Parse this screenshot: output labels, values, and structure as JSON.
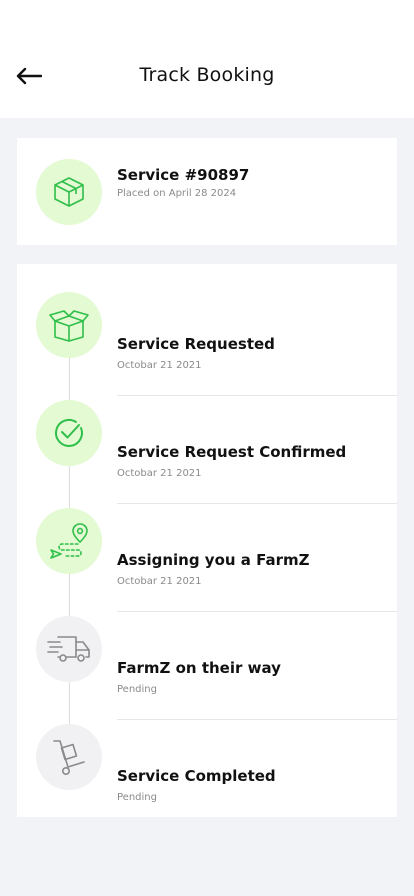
{
  "header": {
    "title": "Track Booking",
    "back_icon": "arrow-left-icon"
  },
  "summary": {
    "icon": "box-icon",
    "service_label": "Service #90897",
    "placed_on": "Placed on April 28 2024"
  },
  "steps": [
    {
      "title": "Service Requested",
      "date": "Octobar 21 2021",
      "status": "done",
      "icon": "open-box-icon"
    },
    {
      "title": "Service Request Confirmed",
      "date": "Octobar 21 2021",
      "status": "done",
      "icon": "check-circle-icon"
    },
    {
      "title": "Assigning you a FarmZ",
      "date": "Octobar 21 2021",
      "status": "done",
      "icon": "route-pin-icon"
    },
    {
      "title": "FarmZ on their way",
      "date": "Pending",
      "status": "pending",
      "icon": "delivery-truck-icon"
    },
    {
      "title": "Service Completed",
      "date": "Pending",
      "status": "pending",
      "icon": "hand-truck-icon"
    }
  ],
  "colors": {
    "accent_green": "#2fbf4a",
    "done_circle": "#e3fad2",
    "pending_circle": "#f1f1f3",
    "pending_icon": "#8a8a8a"
  }
}
